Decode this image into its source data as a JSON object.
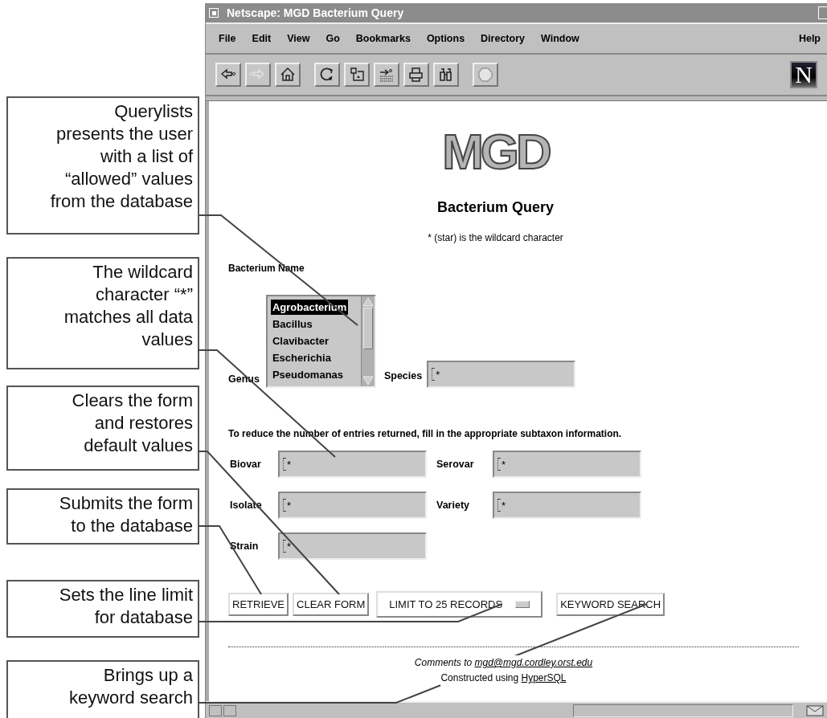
{
  "callouts": [
    {
      "text": "Querylists\npresents the user\nwith a list of\n“allowed” values\nfrom the database"
    },
    {
      "text": "The wildcard\ncharacter “*”\nmatches all data\nvalues"
    },
    {
      "text": "Clears the form\nand restores\ndefault values"
    },
    {
      "text": "Submits the form\nto the database"
    },
    {
      "text": "Sets the line limit\nfor database"
    },
    {
      "text": "Brings up a\nkeyword search"
    }
  ],
  "progress": {
    "level": 0
  },
  "window": {
    "title": "Netscape: MGD Bacterium Query"
  },
  "menu": [
    "File",
    "Edit",
    "View",
    "Go",
    "Bookmarks",
    "Options",
    "Directory",
    "Window",
    "Help"
  ],
  "toolbar": [
    {
      "kind": "back",
      "disabled": false
    },
    {
      "kind": "forward",
      "disabled": true
    },
    {
      "kind": "home",
      "disabled": false
    },
    {
      "kind": "reload",
      "disabled": false
    },
    {
      "kind": "images",
      "disabled": false
    },
    {
      "kind": "open",
      "disabled": false
    },
    {
      "kind": "print",
      "disabled": false
    },
    {
      "kind": "find",
      "disabled": false
    },
    {
      "kind": "stop",
      "disabled": true
    }
  ],
  "brand_mark": "N",
  "page": {
    "logo": "MGD",
    "heading": "Bacterium Query",
    "note": "* (star) is the wildcard character",
    "section_label": "Bacterium Name",
    "genus": {
      "label": "Genus",
      "options": [
        {
          "label": "Agrobacterium",
          "selected": true
        },
        {
          "label": "Bacillus",
          "selected": false
        },
        {
          "label": "Clavibacter",
          "selected": false
        },
        {
          "label": "Escherichia",
          "selected": false
        },
        {
          "label": "Pseudomanas",
          "selected": false
        }
      ]
    },
    "species": {
      "label": "Species",
      "value": "*"
    },
    "hint": "To reduce the number of entries returned, fill in the appropriate subtaxon information.",
    "fields": [
      {
        "label": "Biovar",
        "value": "*"
      },
      {
        "label": "Serovar",
        "value": "*"
      },
      {
        "label": "Isolate",
        "value": "*"
      },
      {
        "label": "Variety",
        "value": "*"
      },
      {
        "label": "Strain",
        "value": "*"
      }
    ],
    "buttons": [
      {
        "kind": "button",
        "label": "RETRIEVE"
      },
      {
        "kind": "button",
        "label": "CLEAR FORM"
      },
      {
        "kind": "dropdown",
        "label": "LIMIT TO 25 RECORDS"
      },
      {
        "kind": "button",
        "label": "KEYWORD SEARCH"
      }
    ],
    "footer": {
      "comments_prefix": "Comments to",
      "email": "mgd@mgd.cordley.orst.edu",
      "constructed_prefix": "Constructed using",
      "tool": "HyperSQL"
    }
  }
}
